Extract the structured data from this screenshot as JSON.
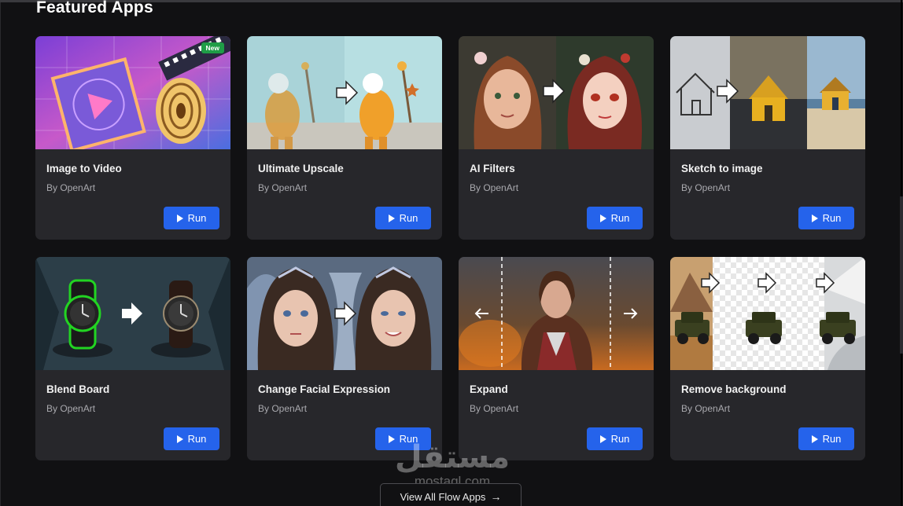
{
  "section": {
    "title": "Featured Apps"
  },
  "apps": [
    {
      "title": "Image to Video",
      "by": "By OpenArt",
      "run_label": "Run",
      "badge": "New"
    },
    {
      "title": "Ultimate Upscale",
      "by": "By OpenArt",
      "run_label": "Run"
    },
    {
      "title": "AI Filters",
      "by": "By OpenArt",
      "run_label": "Run"
    },
    {
      "title": "Sketch to image",
      "by": "By OpenArt",
      "run_label": "Run"
    },
    {
      "title": "Blend Board",
      "by": "By OpenArt",
      "run_label": "Run"
    },
    {
      "title": "Change Facial Expression",
      "by": "By OpenArt",
      "run_label": "Run"
    },
    {
      "title": "Expand",
      "by": "By OpenArt",
      "run_label": "Run"
    },
    {
      "title": "Remove background",
      "by": "By OpenArt",
      "run_label": "Run"
    }
  ],
  "footer": {
    "view_all_label": "View All Flow Apps",
    "arrow_icon": "arrow-right-icon"
  },
  "watermark": {
    "logo": "مستقل",
    "text": "mostaql.com"
  },
  "colors": {
    "background": "#111113",
    "card": "#27272b",
    "accent": "#2563eb",
    "badge": "#1f9d47"
  }
}
